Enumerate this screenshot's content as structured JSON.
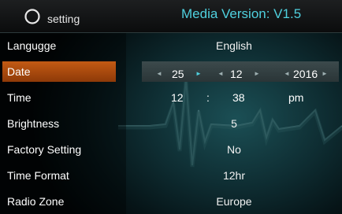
{
  "header": {
    "title": "setting",
    "version": "Media Version: V1.5"
  },
  "rows": {
    "language": {
      "label": "Langugge",
      "value": "English"
    },
    "date": {
      "label": "Date",
      "day": "25",
      "month": "12",
      "year": "2016",
      "left_arrow": "◄",
      "right_arrow": "►"
    },
    "time": {
      "label": "Time",
      "hour": "12",
      "separator": ":",
      "minute": "38",
      "ampm": "pm"
    },
    "brightness": {
      "label": "Brightness",
      "value": "5"
    },
    "factory": {
      "label": "Factory Setting",
      "value": "No"
    },
    "time_format": {
      "label": "Time Format",
      "value": "12hr"
    },
    "radio_zone": {
      "label": "Radio Zone",
      "value": "Europe"
    }
  },
  "colors": {
    "accent": "#4fd0de",
    "selected": "#c35a14"
  }
}
